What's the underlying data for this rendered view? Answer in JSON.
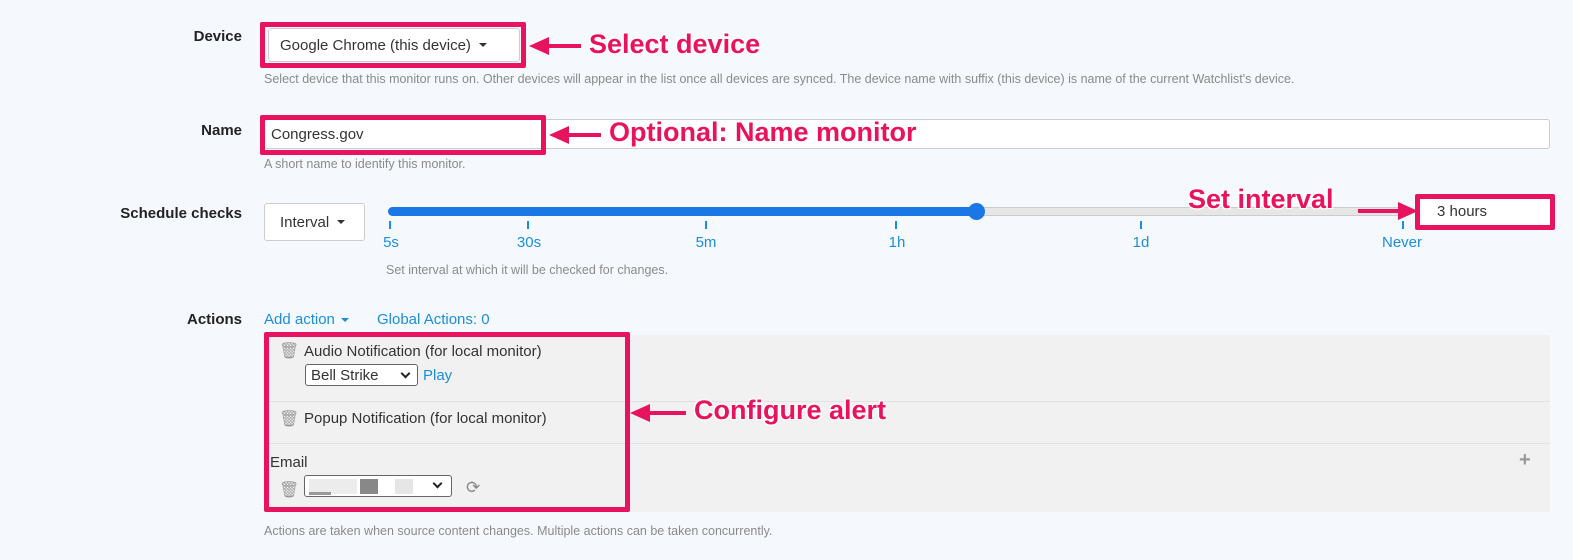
{
  "device": {
    "label": "Device",
    "value": "Google Chrome (this device)",
    "help": "Select device that this monitor runs on. Other devices will appear in the list once all devices are synced. The device name with suffix (this device) is name of the current Watchlist's device."
  },
  "name": {
    "label": "Name",
    "value": "Congress.gov",
    "help": "A short name to identify this monitor."
  },
  "schedule": {
    "label": "Schedule checks",
    "mode": "Interval",
    "ticks": [
      "5s",
      "30s",
      "5m",
      "1h",
      "1d",
      "Never"
    ],
    "slider_position_fraction": 0.58,
    "value": "3 hours",
    "help": "Set interval at which it will be checked for changes."
  },
  "actions": {
    "label": "Actions",
    "add_action": "Add action",
    "global_actions": "Global Actions: 0",
    "audio": {
      "title": "Audio Notification (for local monitor)",
      "sound": "Bell Strike",
      "play": "Play"
    },
    "popup": {
      "title": "Popup Notification (for local monitor)"
    },
    "email": {
      "title": "Email"
    },
    "help": "Actions are taken when source content changes. Multiple actions can be taken concurrently."
  },
  "annotations": {
    "select_device": "Select device",
    "name_monitor": "Optional: Name monitor",
    "set_interval": "Set interval",
    "configure_alert": "Configure alert"
  },
  "colors": {
    "accent": "#1a8fd6",
    "highlight": "#e8135f"
  }
}
